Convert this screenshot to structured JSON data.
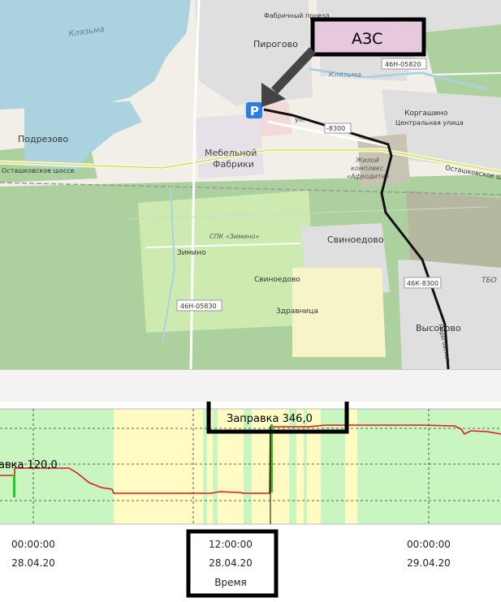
{
  "map": {
    "labels": {
      "klyazma_lake": "Клязьма",
      "klyazma_river": "Клязьма",
      "fabrichny": "Фабричный проезд",
      "pirogovo": "Пирогово",
      "podrezovo": "Подрезово",
      "mebelnoy_1": "Мебельной",
      "mebelnoy_2": "Фабрики",
      "ostashkovskoe_left": "Осташковское шоссе",
      "ostashkovskoe_right": "Осташковское шос",
      "korgashino": "Коргашино",
      "central_street": "Центральная улица",
      "ul": "ул.",
      "road_46n05820": "46Н-05820",
      "road_46n05830": "46Н-05830",
      "road_46k8300": "46К-8300",
      "road_8300": "-8300",
      "zhiloy_1": "Жилой",
      "zhiloy_2": "комплекс",
      "zhiloy_3": "«Афродита»",
      "spk": "СПК «Зимино»",
      "svinoedovo_1": "Свиноедово",
      "svinoedovo_2": "Свиноедово",
      "zimino": "Зимино",
      "zdravnitsa": "Здравница",
      "vysokovo": "Высоково",
      "tbo": "ТБО",
      "road_vert": "Пироговская"
    },
    "parking_symbol": "P",
    "azs_label": "АЗС",
    "colors": {
      "water": "#aad3df",
      "forest": "#add19e",
      "land": "#f2efe9",
      "residential": "#e0dfdf",
      "commercial": "#f2dad9",
      "track": "#111111",
      "parking": "#2a7de1"
    }
  },
  "chart": {
    "annotations": {
      "refuel_small": "авка 120,0",
      "refuel_big": "Заправка 346,0"
    },
    "x_ticks": [
      {
        "time": "00:00:00",
        "date": "28.04.20"
      },
      {
        "time": "12:00:00",
        "date": "28.04.20"
      },
      {
        "time": "00:00:00",
        "date": "29.04.20"
      }
    ],
    "xlabel": "Время",
    "colors": {
      "moving": "#c8f5c0",
      "stopped": "#fffbc2",
      "fuel_line": "#e01a1a",
      "refuel_bar": "#22cc22"
    }
  }
}
